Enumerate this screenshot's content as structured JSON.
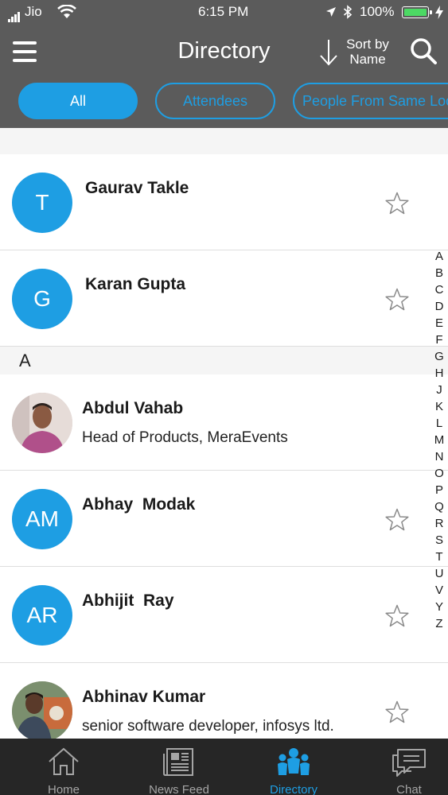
{
  "status_bar": {
    "carrier": "Jio",
    "time": "6:15 PM",
    "battery": "100%"
  },
  "header": {
    "title": "Directory",
    "sort_label_line1": "Sort by",
    "sort_label_line2": "Name"
  },
  "filters": [
    {
      "label": "All",
      "active": true
    },
    {
      "label": "Attendees",
      "active": false
    },
    {
      "label": "People From Same Loc",
      "active": false
    }
  ],
  "contacts_top": [
    {
      "initials": "T",
      "name": "Gaurav Takle",
      "subtitle": ""
    },
    {
      "initials": "G",
      "name": "Karan Gupta",
      "subtitle": ""
    }
  ],
  "section_a": "A",
  "contacts_a": [
    {
      "initials": "",
      "name": "Abdul Vahab",
      "subtitle": "Head of Products, MeraEvents",
      "photo": true
    },
    {
      "initials": "AM",
      "name": "Abhay  Modak",
      "subtitle": ""
    },
    {
      "initials": "AR",
      "name": "Abhijit  Ray",
      "subtitle": ""
    },
    {
      "initials": "",
      "name": "Abhinav Kumar",
      "subtitle": "senior software developer, infosys ltd.",
      "photo": true
    }
  ],
  "alphabet": [
    "A",
    "B",
    "C",
    "D",
    "E",
    "F",
    "G",
    "H",
    "J",
    "K",
    "L",
    "M",
    "N",
    "O",
    "P",
    "Q",
    "R",
    "S",
    "T",
    "U",
    "V",
    "Y",
    "Z"
  ],
  "tabs": [
    {
      "label": "Home",
      "icon": "home-icon",
      "active": false
    },
    {
      "label": "News Feed",
      "icon": "news-feed-icon",
      "active": false
    },
    {
      "label": "Directory",
      "icon": "directory-icon",
      "active": true
    },
    {
      "label": "Chat",
      "icon": "chat-icon",
      "active": false
    }
  ],
  "colors": {
    "accent": "#1e9ee3",
    "header_bg": "#5b5b5b",
    "tabbar_bg": "#262626"
  }
}
